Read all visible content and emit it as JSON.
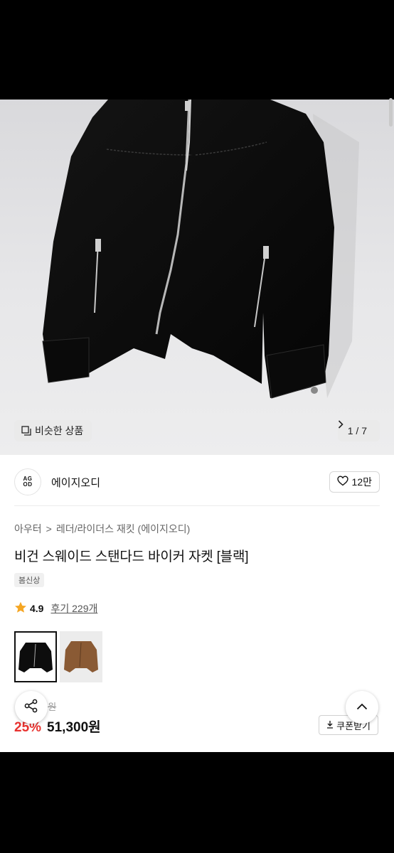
{
  "gallery": {
    "similar_label": "비슷한 상품",
    "counter": "1 / 7"
  },
  "brand": {
    "logo_line1": "AG",
    "logo_line2": "OD",
    "name": "에이지오디",
    "likes": "12만"
  },
  "breadcrumb": {
    "category": "아우터",
    "separator": ">",
    "subcategory": "레더/라이더스 재킷 (에이지오디)"
  },
  "product": {
    "title": "비건 스웨이드 스탠다드 바이커 자켓 [블랙]",
    "tag": "봄신상",
    "rating": "4.9",
    "review_label": "후기 229개",
    "original_price": "9원",
    "discount": "25%",
    "price": "51,300원",
    "coupon_label": "쿠폰받기"
  },
  "colors": {
    "accent_red": "#e8322f",
    "star": "#f5a623"
  }
}
